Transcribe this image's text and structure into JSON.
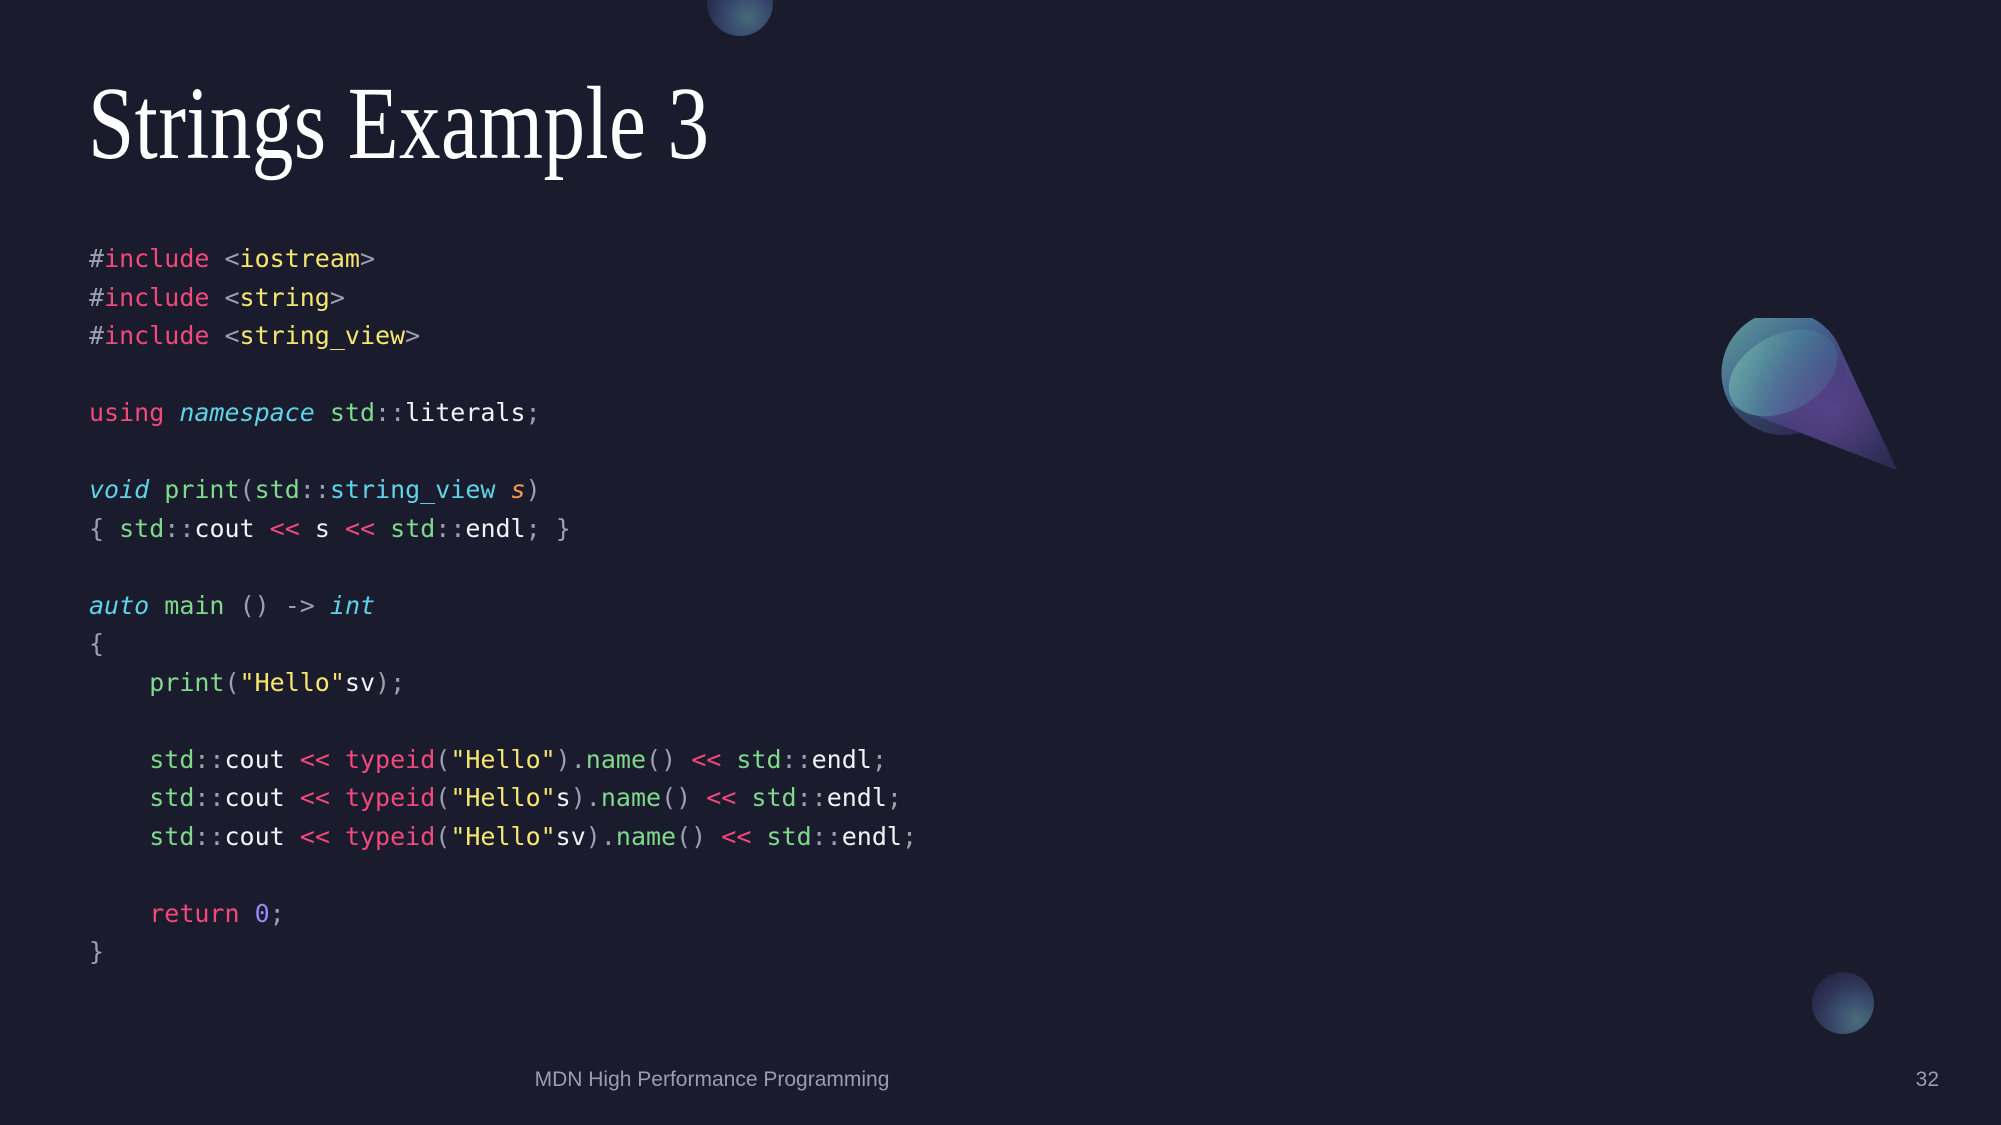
{
  "slide": {
    "title": "Strings Example 3",
    "background_color": "#1b1b2e",
    "footer_text": "MDN High Performance Programming",
    "page_number": "32"
  },
  "decorations": [
    {
      "name": "sphere-top",
      "shape": "sphere",
      "colors": [
        "#4a6f7c",
        "#2e3558",
        "#1f2240"
      ]
    },
    {
      "name": "cone",
      "shape": "cone",
      "colors": [
        "#5f9b9b",
        "#3a5f83",
        "#4b3c7a",
        "#2a2b50"
      ]
    },
    {
      "name": "sphere-bottom",
      "shape": "sphere",
      "colors": [
        "#4e7380",
        "#32395c",
        "#212340"
      ]
    }
  ],
  "palette": {
    "preprocessor": "#f2497b",
    "header_name": "#f5e76e",
    "keyword": "#f2497b",
    "type": "#5ed3e8",
    "namespace": "#7ed98a",
    "function": "#7ed98a",
    "variable": "#ffffff",
    "parameter": "#f79a50",
    "string": "#f5e76e",
    "number": "#9a86f5",
    "operator": "#f2497b",
    "punctuation": "#9aa0b0",
    "plain": "#f2f2f7"
  },
  "code": {
    "language": "cpp",
    "plain_text": "#include <iostream>\n#include <string>\n#include <string_view>\n\nusing namespace std::literals;\n\nvoid print(std::string_view s)\n{ std::cout << s << std::endl; }\n\nauto main () -> int\n{\n    print(\"Hello\"sv);\n\n    std::cout << typeid(\"Hello\").name() << std::endl;\n    std::cout << typeid(\"Hello\"s).name() << std::endl;\n    std::cout << typeid(\"Hello\"sv).name() << std::endl;\n\n    return 0;\n}",
    "lines": [
      {
        "n": 1,
        "tokens": [
          {
            "t": "#",
            "c": "punc"
          },
          {
            "t": "include",
            "c": "pre"
          },
          {
            "t": " ",
            "c": "plain"
          },
          {
            "t": "<",
            "c": "punc"
          },
          {
            "t": "iostream",
            "c": "hdr"
          },
          {
            "t": ">",
            "c": "punc"
          }
        ]
      },
      {
        "n": 2,
        "tokens": [
          {
            "t": "#",
            "c": "punc"
          },
          {
            "t": "include",
            "c": "pre"
          },
          {
            "t": " ",
            "c": "plain"
          },
          {
            "t": "<",
            "c": "punc"
          },
          {
            "t": "string",
            "c": "hdr"
          },
          {
            "t": ">",
            "c": "punc"
          }
        ]
      },
      {
        "n": 3,
        "tokens": [
          {
            "t": "#",
            "c": "punc"
          },
          {
            "t": "include",
            "c": "pre"
          },
          {
            "t": " ",
            "c": "plain"
          },
          {
            "t": "<",
            "c": "punc"
          },
          {
            "t": "string_view",
            "c": "hdr"
          },
          {
            "t": ">",
            "c": "punc"
          }
        ]
      },
      {
        "n": 4,
        "tokens": []
      },
      {
        "n": 5,
        "tokens": [
          {
            "t": "using",
            "c": "kw"
          },
          {
            "t": " ",
            "c": "plain"
          },
          {
            "t": "namespace",
            "c": "type"
          },
          {
            "t": " ",
            "c": "plain"
          },
          {
            "t": "std",
            "c": "ns"
          },
          {
            "t": "::",
            "c": "punc"
          },
          {
            "t": "literals",
            "c": "plain"
          },
          {
            "t": ";",
            "c": "punc"
          }
        ]
      },
      {
        "n": 6,
        "tokens": []
      },
      {
        "n": 7,
        "tokens": [
          {
            "t": "void",
            "c": "type"
          },
          {
            "t": " ",
            "c": "plain"
          },
          {
            "t": "print",
            "c": "fn"
          },
          {
            "t": "(",
            "c": "punc"
          },
          {
            "t": "std",
            "c": "ns"
          },
          {
            "t": "::",
            "c": "punc"
          },
          {
            "t": "string_view",
            "c": "type2"
          },
          {
            "t": " ",
            "c": "plain"
          },
          {
            "t": "s",
            "c": "param"
          },
          {
            "t": ")",
            "c": "punc"
          }
        ]
      },
      {
        "n": 8,
        "tokens": [
          {
            "t": "{",
            "c": "punc"
          },
          {
            "t": " ",
            "c": "plain"
          },
          {
            "t": "std",
            "c": "ns"
          },
          {
            "t": "::",
            "c": "punc"
          },
          {
            "t": "cout",
            "c": "plain"
          },
          {
            "t": " ",
            "c": "plain"
          },
          {
            "t": "<<",
            "c": "op"
          },
          {
            "t": " ",
            "c": "plain"
          },
          {
            "t": "s",
            "c": "plain"
          },
          {
            "t": " ",
            "c": "plain"
          },
          {
            "t": "<<",
            "c": "op"
          },
          {
            "t": " ",
            "c": "plain"
          },
          {
            "t": "std",
            "c": "ns"
          },
          {
            "t": "::",
            "c": "punc"
          },
          {
            "t": "endl",
            "c": "plain"
          },
          {
            "t": ";",
            "c": "punc"
          },
          {
            "t": " ",
            "c": "plain"
          },
          {
            "t": "}",
            "c": "punc"
          }
        ]
      },
      {
        "n": 9,
        "tokens": []
      },
      {
        "n": 10,
        "tokens": [
          {
            "t": "auto",
            "c": "type"
          },
          {
            "t": " ",
            "c": "plain"
          },
          {
            "t": "main",
            "c": "fn"
          },
          {
            "t": " ",
            "c": "plain"
          },
          {
            "t": "()",
            "c": "punc"
          },
          {
            "t": " ",
            "c": "plain"
          },
          {
            "t": "->",
            "c": "punc"
          },
          {
            "t": " ",
            "c": "plain"
          },
          {
            "t": "int",
            "c": "type"
          }
        ]
      },
      {
        "n": 11,
        "tokens": [
          {
            "t": "{",
            "c": "punc"
          }
        ]
      },
      {
        "n": 12,
        "tokens": [
          {
            "t": "    ",
            "c": "plain"
          },
          {
            "t": "print",
            "c": "fn"
          },
          {
            "t": "(",
            "c": "punc"
          },
          {
            "t": "\"Hello\"",
            "c": "str"
          },
          {
            "t": "sv",
            "c": "plain"
          },
          {
            "t": ")",
            "c": "punc"
          },
          {
            "t": ";",
            "c": "punc"
          }
        ]
      },
      {
        "n": 13,
        "tokens": []
      },
      {
        "n": 14,
        "tokens": [
          {
            "t": "    ",
            "c": "plain"
          },
          {
            "t": "std",
            "c": "ns"
          },
          {
            "t": "::",
            "c": "punc"
          },
          {
            "t": "cout",
            "c": "plain"
          },
          {
            "t": " ",
            "c": "plain"
          },
          {
            "t": "<<",
            "c": "op"
          },
          {
            "t": " ",
            "c": "plain"
          },
          {
            "t": "typeid",
            "c": "kw"
          },
          {
            "t": "(",
            "c": "punc"
          },
          {
            "t": "\"Hello\"",
            "c": "str"
          },
          {
            "t": ")",
            "c": "punc"
          },
          {
            "t": ".",
            "c": "punc"
          },
          {
            "t": "name",
            "c": "fn"
          },
          {
            "t": "()",
            "c": "punc"
          },
          {
            "t": " ",
            "c": "plain"
          },
          {
            "t": "<<",
            "c": "op"
          },
          {
            "t": " ",
            "c": "plain"
          },
          {
            "t": "std",
            "c": "ns"
          },
          {
            "t": "::",
            "c": "punc"
          },
          {
            "t": "endl",
            "c": "plain"
          },
          {
            "t": ";",
            "c": "punc"
          }
        ]
      },
      {
        "n": 15,
        "tokens": [
          {
            "t": "    ",
            "c": "plain"
          },
          {
            "t": "std",
            "c": "ns"
          },
          {
            "t": "::",
            "c": "punc"
          },
          {
            "t": "cout",
            "c": "plain"
          },
          {
            "t": " ",
            "c": "plain"
          },
          {
            "t": "<<",
            "c": "op"
          },
          {
            "t": " ",
            "c": "plain"
          },
          {
            "t": "typeid",
            "c": "kw"
          },
          {
            "t": "(",
            "c": "punc"
          },
          {
            "t": "\"Hello\"",
            "c": "str"
          },
          {
            "t": "s",
            "c": "plain"
          },
          {
            "t": ")",
            "c": "punc"
          },
          {
            "t": ".",
            "c": "punc"
          },
          {
            "t": "name",
            "c": "fn"
          },
          {
            "t": "()",
            "c": "punc"
          },
          {
            "t": " ",
            "c": "plain"
          },
          {
            "t": "<<",
            "c": "op"
          },
          {
            "t": " ",
            "c": "plain"
          },
          {
            "t": "std",
            "c": "ns"
          },
          {
            "t": "::",
            "c": "punc"
          },
          {
            "t": "endl",
            "c": "plain"
          },
          {
            "t": ";",
            "c": "punc"
          }
        ]
      },
      {
        "n": 16,
        "tokens": [
          {
            "t": "    ",
            "c": "plain"
          },
          {
            "t": "std",
            "c": "ns"
          },
          {
            "t": "::",
            "c": "punc"
          },
          {
            "t": "cout",
            "c": "plain"
          },
          {
            "t": " ",
            "c": "plain"
          },
          {
            "t": "<<",
            "c": "op"
          },
          {
            "t": " ",
            "c": "plain"
          },
          {
            "t": "typeid",
            "c": "kw"
          },
          {
            "t": "(",
            "c": "punc"
          },
          {
            "t": "\"Hello\"",
            "c": "str"
          },
          {
            "t": "sv",
            "c": "plain"
          },
          {
            "t": ")",
            "c": "punc"
          },
          {
            "t": ".",
            "c": "punc"
          },
          {
            "t": "name",
            "c": "fn"
          },
          {
            "t": "()",
            "c": "punc"
          },
          {
            "t": " ",
            "c": "plain"
          },
          {
            "t": "<<",
            "c": "op"
          },
          {
            "t": " ",
            "c": "plain"
          },
          {
            "t": "std",
            "c": "ns"
          },
          {
            "t": "::",
            "c": "punc"
          },
          {
            "t": "endl",
            "c": "plain"
          },
          {
            "t": ";",
            "c": "punc"
          }
        ]
      },
      {
        "n": 17,
        "tokens": []
      },
      {
        "n": 18,
        "tokens": [
          {
            "t": "    ",
            "c": "plain"
          },
          {
            "t": "return",
            "c": "kw"
          },
          {
            "t": " ",
            "c": "plain"
          },
          {
            "t": "0",
            "c": "num"
          },
          {
            "t": ";",
            "c": "punc"
          }
        ]
      },
      {
        "n": 19,
        "tokens": [
          {
            "t": "}",
            "c": "punc"
          }
        ]
      }
    ]
  }
}
